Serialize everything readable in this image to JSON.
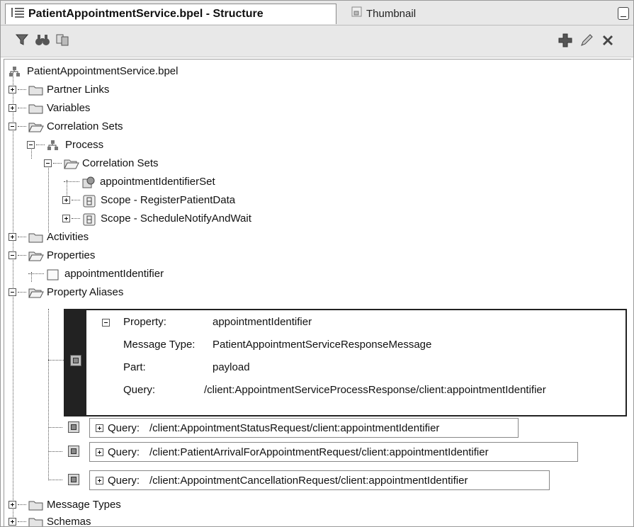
{
  "tabs": {
    "structure": "PatientAppointmentService.bpel - Structure",
    "thumbnail": "Thumbnail"
  },
  "tree": {
    "root": "PatientAppointmentService.bpel",
    "partner_links": "Partner Links",
    "variables": "Variables",
    "correlation_sets": "Correlation Sets",
    "process": "Process",
    "process_correlation_sets": "Correlation Sets",
    "correlation_set_item": "appointmentIdentifierSet",
    "scope_register": "Scope - RegisterPatientData",
    "scope_schedule": "Scope - ScheduleNotifyAndWait",
    "activities": "Activities",
    "properties": "Properties",
    "property_item": "appointmentIdentifier",
    "property_aliases": "Property Aliases",
    "message_types": "Message Types",
    "schemas": "Schemas"
  },
  "alias_selected": {
    "property_label": "Property:",
    "property_value": "appointmentIdentifier",
    "message_type_label": "Message Type:",
    "message_type_value": "PatientAppointmentServiceResponseMessage",
    "part_label": "Part:",
    "part_value": "payload",
    "query_label": "Query:",
    "query_value": "/client:AppointmentServiceProcessResponse/client:appointmentIdentifier"
  },
  "aliases": [
    {
      "query_label": "Query:",
      "query_value": "/client:AppointmentStatusRequest/client:appointmentIdentifier"
    },
    {
      "query_label": "Query:",
      "query_value": "/client:PatientArrivalForAppointmentRequest/client:appointmentIdentifier"
    },
    {
      "query_label": "Query:",
      "query_value": "/client:AppointmentCancellationRequest/client:appointmentIdentifier"
    }
  ]
}
